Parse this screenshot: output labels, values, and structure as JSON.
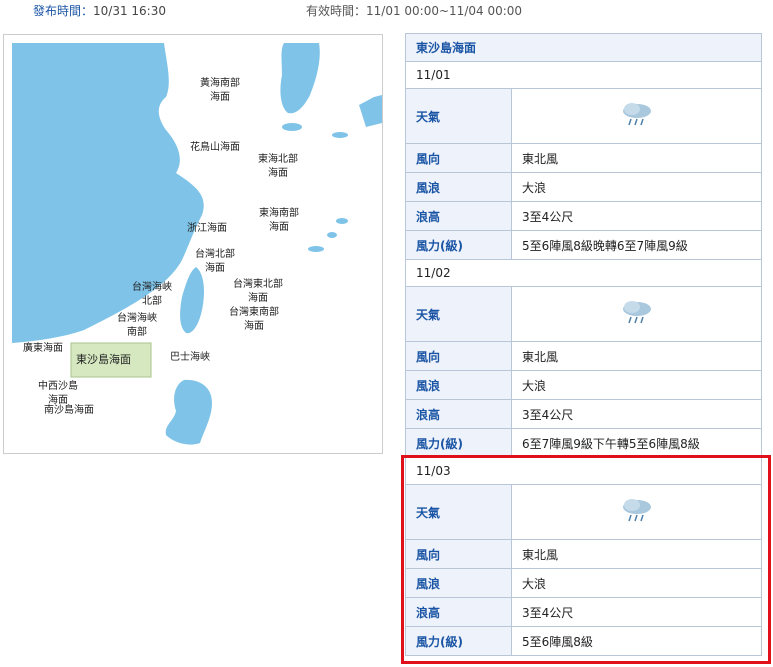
{
  "header": {
    "publish_label": "發布時間：",
    "publish_value": "10/31 16:30",
    "valid_label": "有效時間：",
    "valid_value": "11/01 00:00~11/04 00:00"
  },
  "map": {
    "labels": {
      "yellow_sea_south": "黃海南部海面",
      "huaniao": "花鳥山海面",
      "east_china_north": "東海北部海面",
      "east_china_south": "東海南部海面",
      "zhejiang": "浙江海面",
      "taiwan_north": "台灣北部海面",
      "taiwan_strait_north": "台灣海峽北部",
      "taiwan_ne": "台灣東北部海面",
      "taiwan_strait_south": "台灣海峽南部",
      "taiwan_se": "台灣東南部海面",
      "guangdong": "廣東海面",
      "dongsha": "東沙島海面",
      "bashi": "巴士海峽",
      "zhongxisha": "中西沙島海面",
      "nansha": "南沙島海面"
    },
    "colors": {
      "sea": "#7fc4e8",
      "selected": "#d6e8c0"
    }
  },
  "forecast": {
    "region": "東沙島海面",
    "labels": {
      "weather": "天氣",
      "wind_dir": "風向",
      "wave": "風浪",
      "wave_height": "浪高",
      "wind_force": "風力(級)"
    },
    "days": [
      {
        "date": "11/01",
        "weather_icon": "rain-cloud-icon",
        "wind_dir": "東北風",
        "wave": "大浪",
        "wave_height": "3至4公尺",
        "wind_force": "5至6陣風8級晚轉6至7陣風9級"
      },
      {
        "date": "11/02",
        "weather_icon": "rain-cloud-icon",
        "wind_dir": "東北風",
        "wave": "大浪",
        "wave_height": "3至4公尺",
        "wind_force": "6至7陣風9級下午轉5至6陣風8級"
      },
      {
        "date": "11/03",
        "weather_icon": "rain-cloud-icon",
        "wind_dir": "東北風",
        "wave": "大浪",
        "wave_height": "3至4公尺",
        "wind_force": "5至6陣風8級"
      }
    ],
    "highlight_color": "#e0101a"
  }
}
